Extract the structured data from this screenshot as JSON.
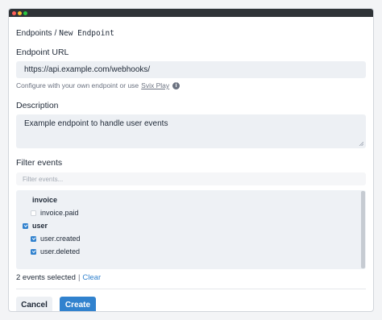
{
  "colors": {
    "accent": "#3182ce",
    "titlebar": "#2f3337",
    "dot_red": "#ff5f57",
    "dot_yellow": "#febc2e",
    "dot_green": "#28c840"
  },
  "breadcrumb": {
    "parent": "Endpoints",
    "separator": "/",
    "current": "New Endpoint"
  },
  "endpoint_url": {
    "label": "Endpoint URL",
    "value": "https://api.example.com/webhooks/"
  },
  "hint": {
    "text": "Configure with your own endpoint or use",
    "link": "Svix Play",
    "icon": "info-icon"
  },
  "description": {
    "label": "Description",
    "value": "Example endpoint to handle user events"
  },
  "filter": {
    "label": "Filter events",
    "placeholder": "Filter events..."
  },
  "tree": [
    {
      "label": "invoice",
      "checked": false,
      "group": true
    },
    {
      "label": "invoice.paid",
      "checked": false,
      "group": false
    },
    {
      "label": "user",
      "checked": true,
      "group": true
    },
    {
      "label": "user.created",
      "checked": true,
      "group": false
    },
    {
      "label": "user.deleted",
      "checked": true,
      "group": false
    }
  ],
  "selection": {
    "count_text": "2 events selected",
    "separator": "|",
    "clear": "Clear"
  },
  "actions": {
    "cancel": "Cancel",
    "create": "Create"
  }
}
